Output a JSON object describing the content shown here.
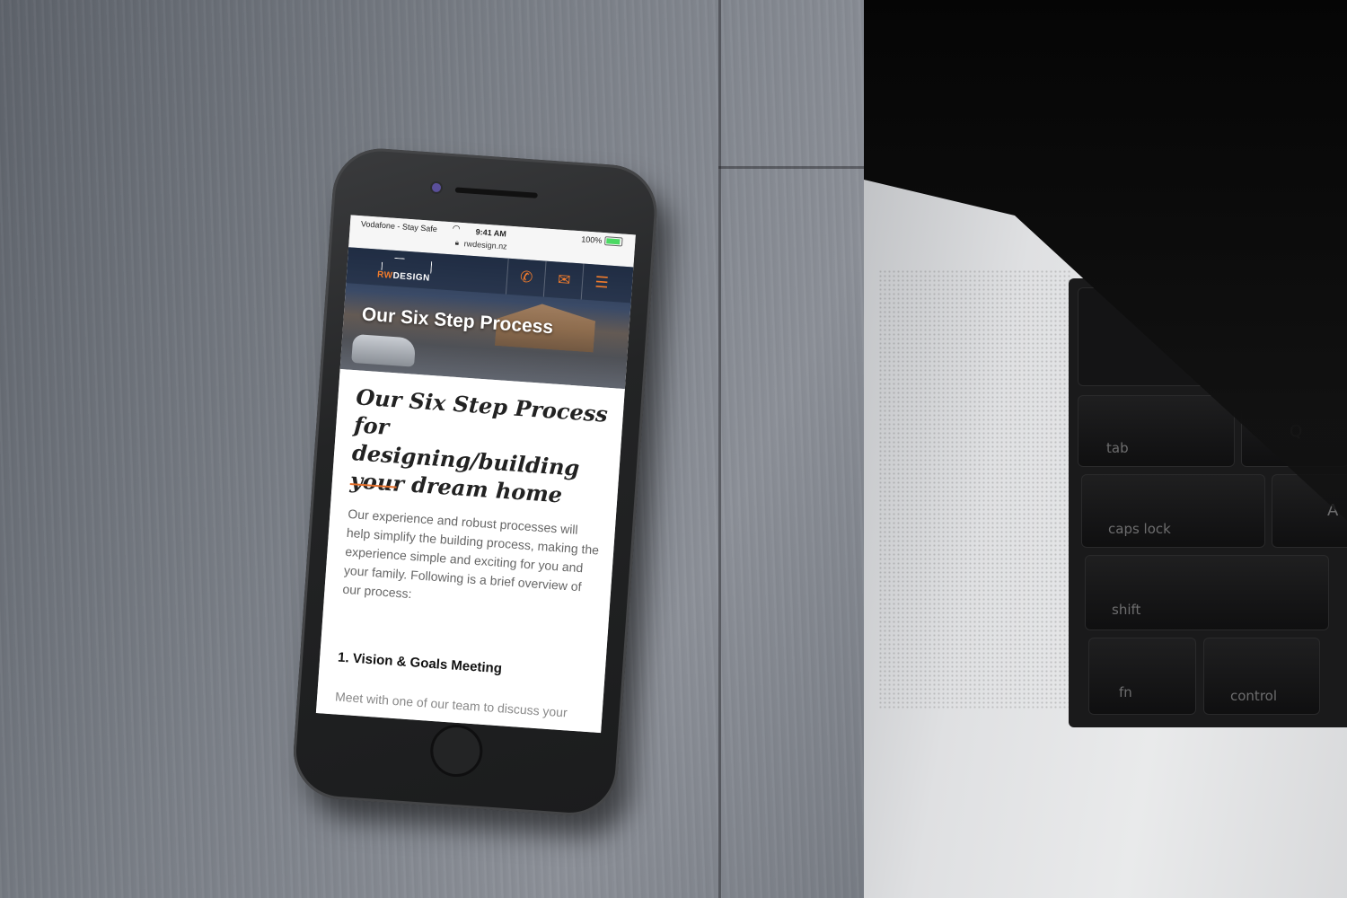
{
  "status_bar": {
    "carrier": "Vodafone - Stay Safe",
    "time": "9:41 AM",
    "battery": "100%",
    "url": "rwdesign.nz"
  },
  "site": {
    "logo": {
      "prefix": "RW",
      "suffix": "DESIGN"
    },
    "nav": [
      {
        "icon": "phone-icon",
        "glyph": "✆"
      },
      {
        "icon": "mail-icon",
        "glyph": "✉"
      },
      {
        "icon": "menu-icon",
        "glyph": "☰"
      }
    ],
    "hero_title": "Our Six Step Process",
    "heading": "Our Six Step Process for designing/building your dream home",
    "intro": "Our experience and robust processes will help simplify the building process, making the experience simple and exciting for you and your family. Following is a brief overview of our process:",
    "first_step": {
      "title": "1. Vision & Goals Meeting",
      "description": "Meet with one of our team to discuss your"
    }
  },
  "keyboard": {
    "keys": [
      "tab",
      "Q",
      "caps lock",
      "A",
      "shift",
      "fn",
      "control"
    ]
  },
  "colors": {
    "accent": "#e36f2b",
    "brand_orange": "#f07b2c"
  }
}
